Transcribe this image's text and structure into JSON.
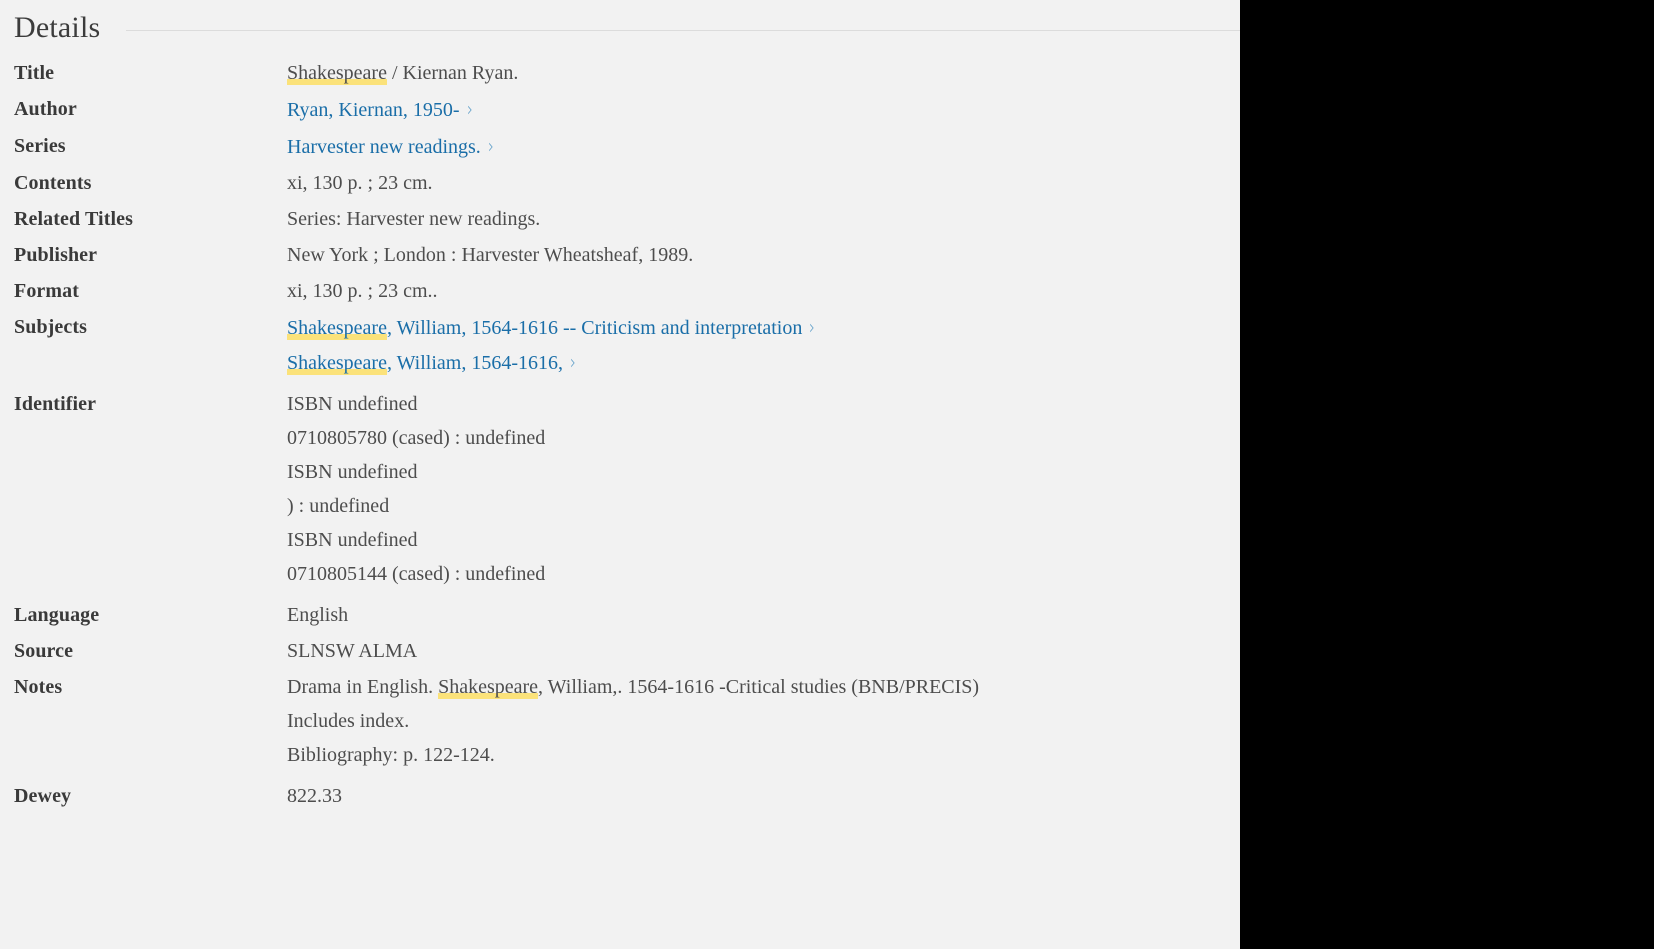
{
  "panel": {
    "heading": "Details",
    "highlight_term": "Shakespeare",
    "colors": {
      "background": "#f2f2f2",
      "label_text": "#3a3a3a",
      "value_text": "#4d4d4d",
      "link": "#1a6ea8",
      "chevron": "#5f9fc9",
      "highlight": "#fbe27a",
      "rule": "#dcdcdc",
      "masked_area": "#000000"
    }
  },
  "fields": {
    "title": {
      "label": "Title",
      "highlight": "Shakespeare",
      "rest": " / Kiernan Ryan."
    },
    "author": {
      "label": "Author",
      "link": "Ryan, Kiernan, 1950-",
      "chevron": "chevron-right-icon"
    },
    "series": {
      "label": "Series",
      "link": "Harvester new readings.",
      "chevron": "chevron-right-icon"
    },
    "contents": {
      "label": "Contents",
      "value": "xi, 130 p. ; 23 cm."
    },
    "related_titles": {
      "label": "Related Titles",
      "value": "Series: Harvester new readings."
    },
    "publisher": {
      "label": "Publisher",
      "value": "New York ; London : Harvester Wheatsheaf, 1989."
    },
    "format": {
      "label": "Format",
      "value": "xi, 130 p. ; 23 cm.."
    },
    "subjects": {
      "label": "Subjects",
      "items": [
        {
          "highlight": "Shakespeare",
          "rest": ", William, 1564-1616 -- Criticism and interpretation"
        },
        {
          "highlight": "Shakespeare",
          "rest": ", William, 1564-1616,"
        }
      ]
    },
    "identifier": {
      "label": "Identifier",
      "lines": [
        "ISBN  undefined",
        "0710805780 (cased) : undefined",
        "ISBN  undefined",
        ") : undefined",
        "ISBN  undefined",
        "0710805144 (cased) : undefined"
      ]
    },
    "language": {
      "label": "Language",
      "value": "English"
    },
    "source": {
      "label": "Source",
      "value": "SLNSW ALMA"
    },
    "notes": {
      "label": "Notes",
      "first_line": {
        "before": "Drama in English. ",
        "highlight": "Shakespeare",
        "after": ", William,. 1564-1616 -Critical studies (BNB/PRECIS)"
      },
      "lines": [
        "Includes index.",
        "Bibliography: p. 122-124."
      ]
    },
    "dewey": {
      "label": "Dewey",
      "value": "822.33"
    }
  }
}
